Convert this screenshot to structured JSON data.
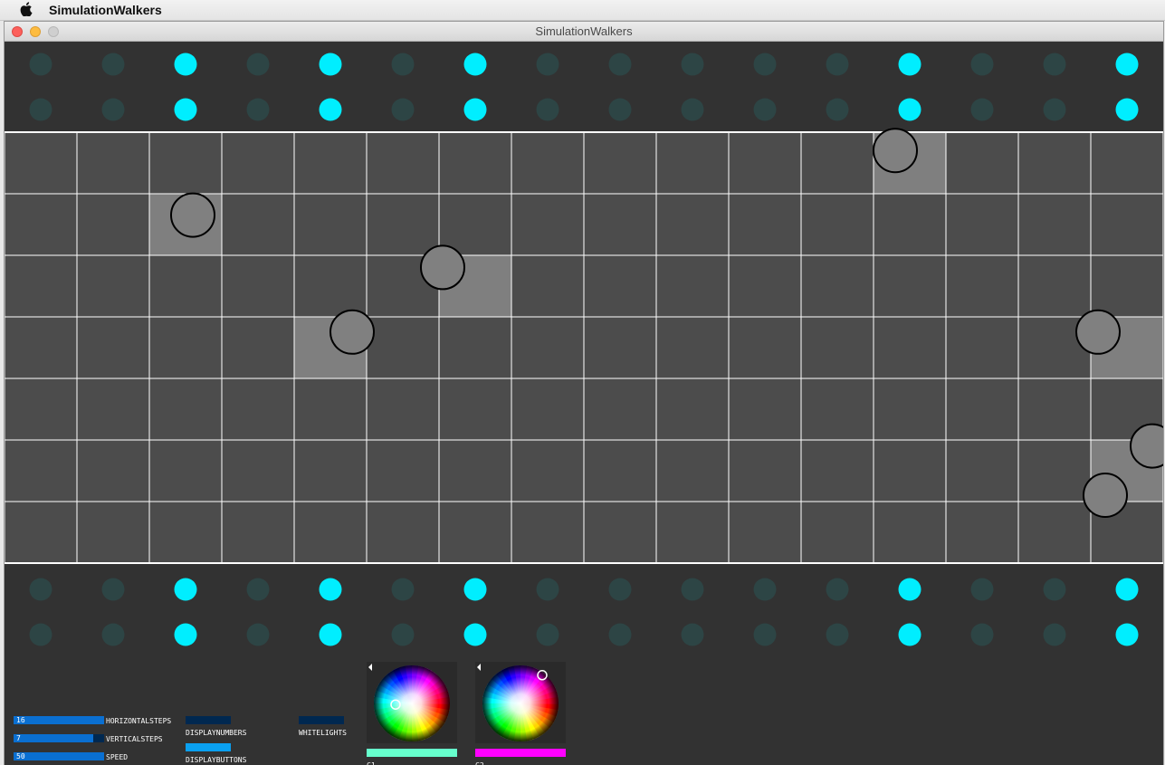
{
  "menubar": {
    "app_name": "SimulationWalkers",
    "apple_icon": "apple-logo-icon"
  },
  "window": {
    "title": "SimulationWalkers"
  },
  "colors": {
    "led_on": "#00eeff",
    "led_off": "#2d4545",
    "background": "#323232",
    "cell": "#4c4c4c",
    "cell_active": "#7f7f7f",
    "grid_line": "#ffffff",
    "walker": "#808080",
    "slider_fg": "#0a6fd1",
    "slider_bg": "#002850",
    "toggle_off": "#002850",
    "toggle_on": "#0aa0f0"
  },
  "grid": {
    "columns": 16,
    "rows": 7,
    "active_cells": [
      [
        2,
        1
      ],
      [
        12,
        0
      ],
      [
        6,
        2
      ],
      [
        4,
        3
      ],
      [
        15,
        3
      ],
      [
        15,
        5
      ]
    ],
    "walkers": [
      [
        2.6,
        1.2
      ],
      [
        12.3,
        0.15
      ],
      [
        6.05,
        2.05
      ],
      [
        4.8,
        3.1
      ],
      [
        15.1,
        3.1
      ],
      [
        15.85,
        4.95
      ],
      [
        15.2,
        5.75
      ]
    ]
  },
  "led_rows": {
    "lit_columns": [
      2,
      4,
      6,
      12,
      15
    ],
    "count": 16
  },
  "controls": {
    "sliders": [
      {
        "value_text": "16",
        "label": "HORIZONTALSTEPS",
        "fraction": 1.0
      },
      {
        "value_text": "7",
        "label": "VERTICALSTEPS",
        "fraction": 0.88
      },
      {
        "value_text": "50",
        "label": "SPEED",
        "fraction": 1.0
      }
    ],
    "toggles": {
      "display_numbers": {
        "label": "DISPLAYNUMBERS",
        "on": false
      },
      "display_buttons": {
        "label": "DISPLAYBUTTONS",
        "on": true
      },
      "white_lights": {
        "label": "WHITELIGHTS",
        "on": false
      }
    },
    "color_pickers": [
      {
        "label": "C1",
        "color": "#66ffcc",
        "handle": [
          0.22,
          0.58
        ]
      },
      {
        "label": "C2",
        "color": "#ff00ff",
        "handle": [
          0.64,
          0.22
        ]
      }
    ]
  }
}
